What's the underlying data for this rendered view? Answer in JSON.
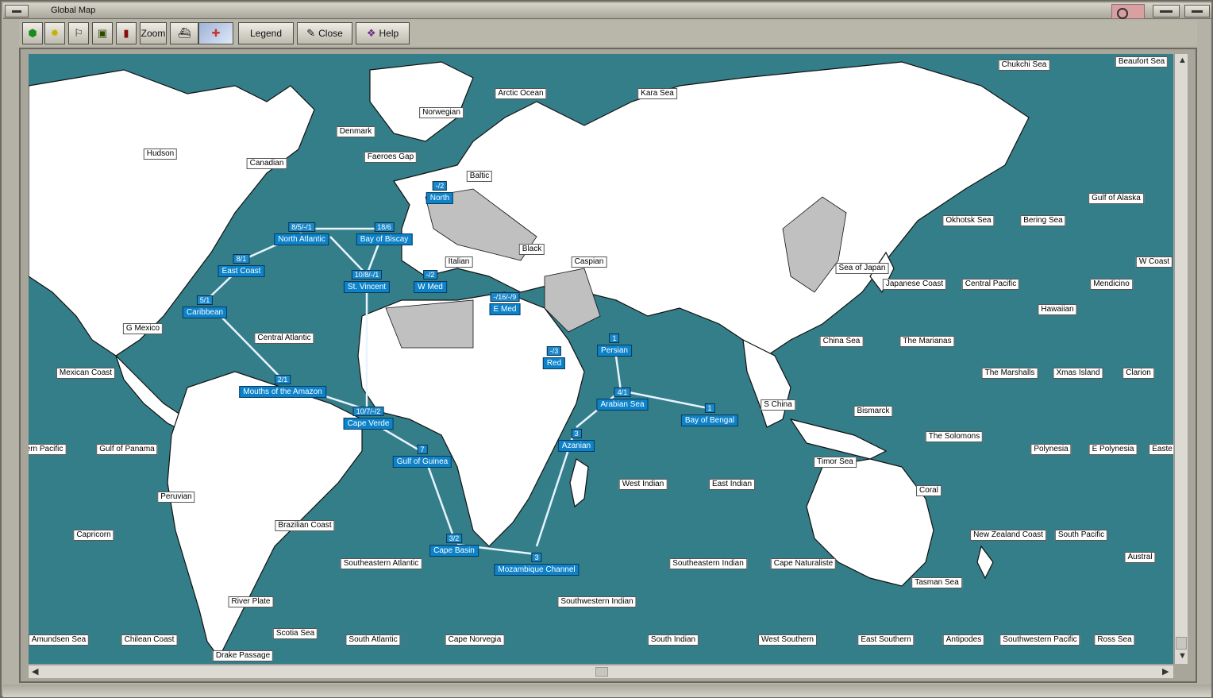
{
  "window": {
    "title": "Global Map"
  },
  "toolbar": {
    "zoom_label": "Zoom",
    "legend_label": "Legend",
    "close_label": "Close",
    "help_label": "Help",
    "icons": [
      "green-hex-icon",
      "yellow-star-icon",
      "flag-icon",
      "save-map-icon",
      "red-pen-icon",
      "zoom-icon",
      "ship-silhouette-icon",
      "union-jack-icon"
    ]
  },
  "colors": {
    "ocean": "#347e89",
    "land": "#ffffff",
    "neutral": "#c0c0c0",
    "route": "#e8f4ff",
    "zone_box": "#0d82c9"
  },
  "map": {
    "sea_labels": [
      {
        "name": "Chukchi Sea"
      },
      {
        "name": "Beaufort Sea"
      },
      {
        "name": "Arctic Ocean"
      },
      {
        "name": "Kara Sea"
      },
      {
        "name": "Norwegian"
      },
      {
        "name": "Denmark"
      },
      {
        "name": "Hudson"
      },
      {
        "name": "Canadian"
      },
      {
        "name": "Faeroes Gap"
      },
      {
        "name": "Baltic"
      },
      {
        "name": "Gulf of Alaska"
      },
      {
        "name": "Okhotsk Sea"
      },
      {
        "name": "Bering Sea"
      },
      {
        "name": "Black"
      },
      {
        "name": "Italian"
      },
      {
        "name": "Caspian"
      },
      {
        "name": "Sea of Japan"
      },
      {
        "name": "W Coast"
      },
      {
        "name": "Japanese Coast"
      },
      {
        "name": "Central Pacific"
      },
      {
        "name": "Mendicino"
      },
      {
        "name": "Hawaiian"
      },
      {
        "name": "G Mexico"
      },
      {
        "name": "Central Atlantic"
      },
      {
        "name": "China Sea"
      },
      {
        "name": "The Marianas"
      },
      {
        "name": "Mexican Coast"
      },
      {
        "name": "The Marshalls"
      },
      {
        "name": "Xmas Island"
      },
      {
        "name": "Clarion"
      },
      {
        "name": "S China"
      },
      {
        "name": "Bismarck"
      },
      {
        "name": "The Solomons"
      },
      {
        "name": "ern Pacific"
      },
      {
        "name": "Gulf of Panama"
      },
      {
        "name": "Polynesia"
      },
      {
        "name": "E Polynesia"
      },
      {
        "name": "Easte"
      },
      {
        "name": "Timor Sea"
      },
      {
        "name": "West Indian"
      },
      {
        "name": "East Indian"
      },
      {
        "name": "Peruvian"
      },
      {
        "name": "Coral"
      },
      {
        "name": "Capricorn"
      },
      {
        "name": "Brazilian Coast"
      },
      {
        "name": "New Zealand Coast"
      },
      {
        "name": "South Pacific"
      },
      {
        "name": "Austral"
      },
      {
        "name": "Southeastern Atlantic"
      },
      {
        "name": "Southeastern Indian"
      },
      {
        "name": "Cape Naturaliste"
      },
      {
        "name": "Tasman Sea"
      },
      {
        "name": "River Plate"
      },
      {
        "name": "Southwestern Indian"
      },
      {
        "name": "Amundsen Sea"
      },
      {
        "name": "Chilean Coast"
      },
      {
        "name": "Scotia Sea"
      },
      {
        "name": "South Atlantic"
      },
      {
        "name": "Cape Norvegia"
      },
      {
        "name": "South Indian"
      },
      {
        "name": "West Southern"
      },
      {
        "name": "East Southern"
      },
      {
        "name": "Antipodes"
      },
      {
        "name": "Southwestern Pacific"
      },
      {
        "name": "Ross Sea"
      },
      {
        "name": "Drake Passage"
      }
    ],
    "zones": [
      {
        "name": "North",
        "count": "-/2"
      },
      {
        "name": "North Atlantic",
        "count": "8/5/-/1"
      },
      {
        "name": "Bay of Biscay",
        "count": "18/6"
      },
      {
        "name": "East Coast",
        "count": "8/1"
      },
      {
        "name": "St. Vincent",
        "count": "10/8/-/1"
      },
      {
        "name": "W Med",
        "count": "-/2"
      },
      {
        "name": "E Med",
        "count": "-/16/-/9"
      },
      {
        "name": "Caribbean",
        "count": "5/1"
      },
      {
        "name": "Red",
        "count": "-/3"
      },
      {
        "name": "Persian",
        "count": "1"
      },
      {
        "name": "Mouths of the Amazon",
        "count": "2/1"
      },
      {
        "name": "Arabian Sea",
        "count": "4/1"
      },
      {
        "name": "Bay of Bengal",
        "count": "1"
      },
      {
        "name": "Cape Verde",
        "count": "10/7/-/2"
      },
      {
        "name": "Azanian",
        "count": "3"
      },
      {
        "name": "Gulf of Guinea",
        "count": "7"
      },
      {
        "name": "Cape Basin",
        "count": "3/2"
      },
      {
        "name": "Mozambique Channel",
        "count": "3"
      }
    ]
  }
}
